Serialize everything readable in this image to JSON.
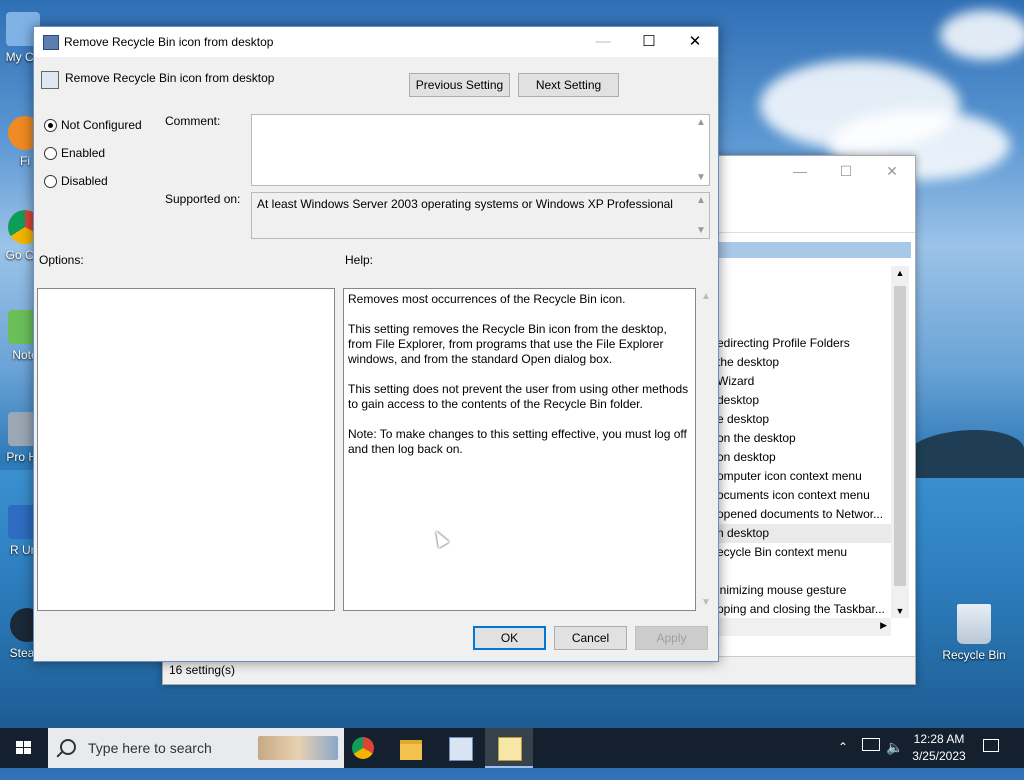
{
  "desktop": {
    "icons": [
      {
        "label": "My Co"
      },
      {
        "label": "Fi"
      },
      {
        "label": "Go Chr"
      },
      {
        "label": "Note"
      },
      {
        "label": "Pro Ha"
      },
      {
        "label": "R Uni"
      },
      {
        "label": "Steam"
      }
    ],
    "recycle_bin_label": "Recycle Bin"
  },
  "background_window": {
    "list_items": [
      "edirecting Profile Folders",
      "the desktop",
      "Wizard",
      "desktop",
      "e desktop",
      "on the desktop",
      "on desktop",
      "omputer icon context menu",
      "ocuments icon context menu",
      "opened documents to Networ...",
      "n desktop",
      "ecycle Bin context menu",
      "",
      "inimizing mouse gesture",
      "pping and closing the Taskbar..."
    ],
    "status_text": "16 setting(s)"
  },
  "dialog": {
    "title": "Remove Recycle Bin icon from desktop",
    "header": "Remove Recycle Bin icon from desktop",
    "prev_button": "Previous Setting",
    "next_button": "Next Setting",
    "radio": {
      "not_configured": "Not Configured",
      "enabled": "Enabled",
      "disabled": "Disabled",
      "selected": "Not Configured"
    },
    "comment_label": "Comment:",
    "comment_value": "",
    "supported_label": "Supported on:",
    "supported_value": "At least Windows Server 2003 operating systems or Windows XP Professional",
    "options_label": "Options:",
    "help_label": "Help:",
    "help_paragraphs": [
      "Removes most occurrences of the Recycle Bin icon.",
      "This setting removes the Recycle Bin icon from the desktop, from File Explorer, from programs that use the File Explorer windows, and from the standard Open dialog box.",
      "This setting does not prevent the user from using other methods to gain access to the contents of the Recycle Bin folder.",
      "Note: To make changes to this setting effective, you must log off and then log back on."
    ],
    "ok_button": "OK",
    "cancel_button": "Cancel",
    "apply_button": "Apply"
  },
  "taskbar": {
    "search_placeholder": "Type here to search",
    "time": "12:28 AM",
    "date": "3/25/2023"
  }
}
